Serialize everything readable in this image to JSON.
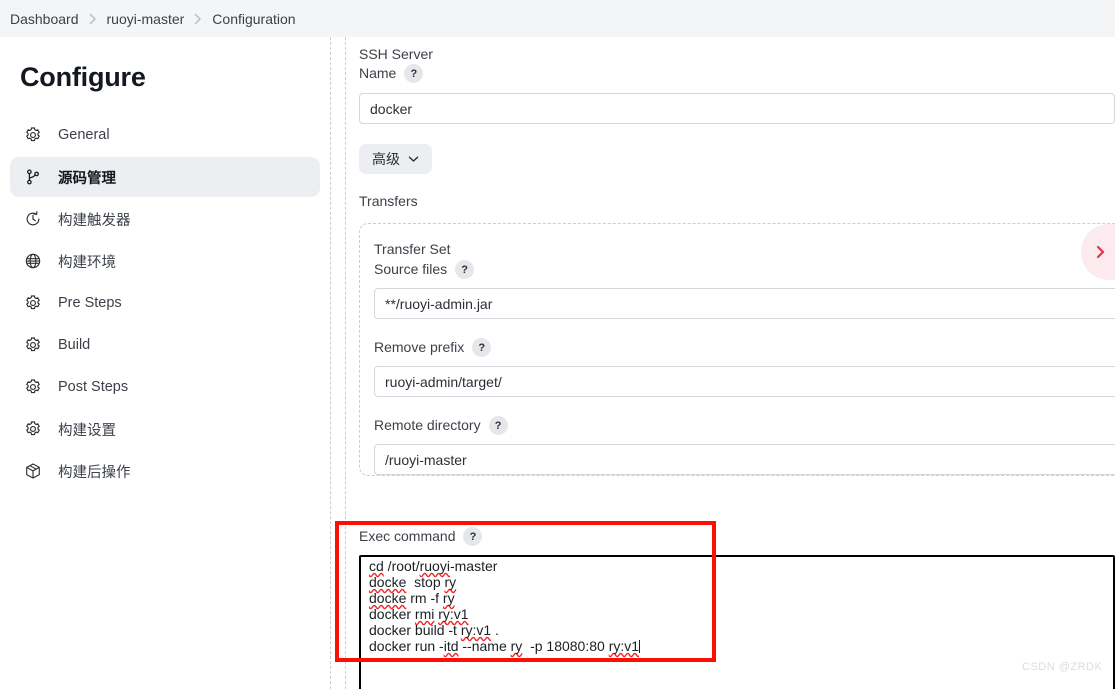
{
  "breadcrumb": {
    "items": [
      {
        "label": "Dashboard"
      },
      {
        "label": "ruoyi-master"
      },
      {
        "label": "Configuration"
      }
    ]
  },
  "sidebar": {
    "title": "Configure",
    "items": [
      {
        "label": "General",
        "icon": "gear-icon",
        "selected": false
      },
      {
        "label": "源码管理",
        "icon": "git-branch-icon",
        "selected": true
      },
      {
        "label": "构建触发器",
        "icon": "clock-icon",
        "selected": false
      },
      {
        "label": "构建环境",
        "icon": "globe-icon",
        "selected": false
      },
      {
        "label": "Pre Steps",
        "icon": "gear-icon",
        "selected": false
      },
      {
        "label": "Build",
        "icon": "gear-icon",
        "selected": false
      },
      {
        "label": "Post Steps",
        "icon": "gear-icon",
        "selected": false
      },
      {
        "label": "构建设置",
        "icon": "gear-icon",
        "selected": false
      },
      {
        "label": "构建后操作",
        "icon": "package-icon",
        "selected": false
      }
    ]
  },
  "form": {
    "ssh_server_name": {
      "label_line1": "SSH Server",
      "label_line2": "Name",
      "help": "?",
      "value": "docker"
    },
    "advanced_button": {
      "label": "高级",
      "icon": "chevron-down-icon"
    },
    "transfers_label": "Transfers",
    "transfer_set": {
      "title": "Transfer Set",
      "source_files": {
        "label": "Source files",
        "help": "?",
        "value": "**/ruoyi-admin.jar"
      },
      "remove_prefix": {
        "label": "Remove prefix",
        "help": "?",
        "value": "ruoyi-admin/target/"
      },
      "remote_directory": {
        "label": "Remote directory",
        "help": "?",
        "value": "/ruoyi-master"
      },
      "exec_command": {
        "label": "Exec command",
        "help": "?",
        "value": "cd /root/ruoyi-master\ndocke  stop ry\ndocke rm -f ry\ndocker rmi ry:v1\ndocker build -t ry:v1 .\ndocker run -itd --name ry  -p 18080:80 ry:v1",
        "lines": [
          "cd /root/ruoyi-master",
          "docke  stop ry",
          "docke rm -f ry",
          "docker rmi ry:v1",
          "docker build -t ry:v1 .",
          "docker run -itd --name ry  -p 18080:80 ry:v1"
        ]
      }
    }
  },
  "annotation": {
    "highlight_color": "#fb0f06",
    "edge_badge_icon": "chevron-right-icon"
  },
  "watermark": {
    "text": "CSDN @ZRDK"
  },
  "colors": {
    "breadcrumb_bg": "#f4f5f7",
    "selected_nav_bg": "#eceef2",
    "input_border": "#d3d7dd",
    "text_primary": "#14181f",
    "text_secondary": "#3c4149",
    "highlight_red": "#fb0f06",
    "badge_pink": "#fcebee",
    "badge_red": "#e8304a"
  }
}
